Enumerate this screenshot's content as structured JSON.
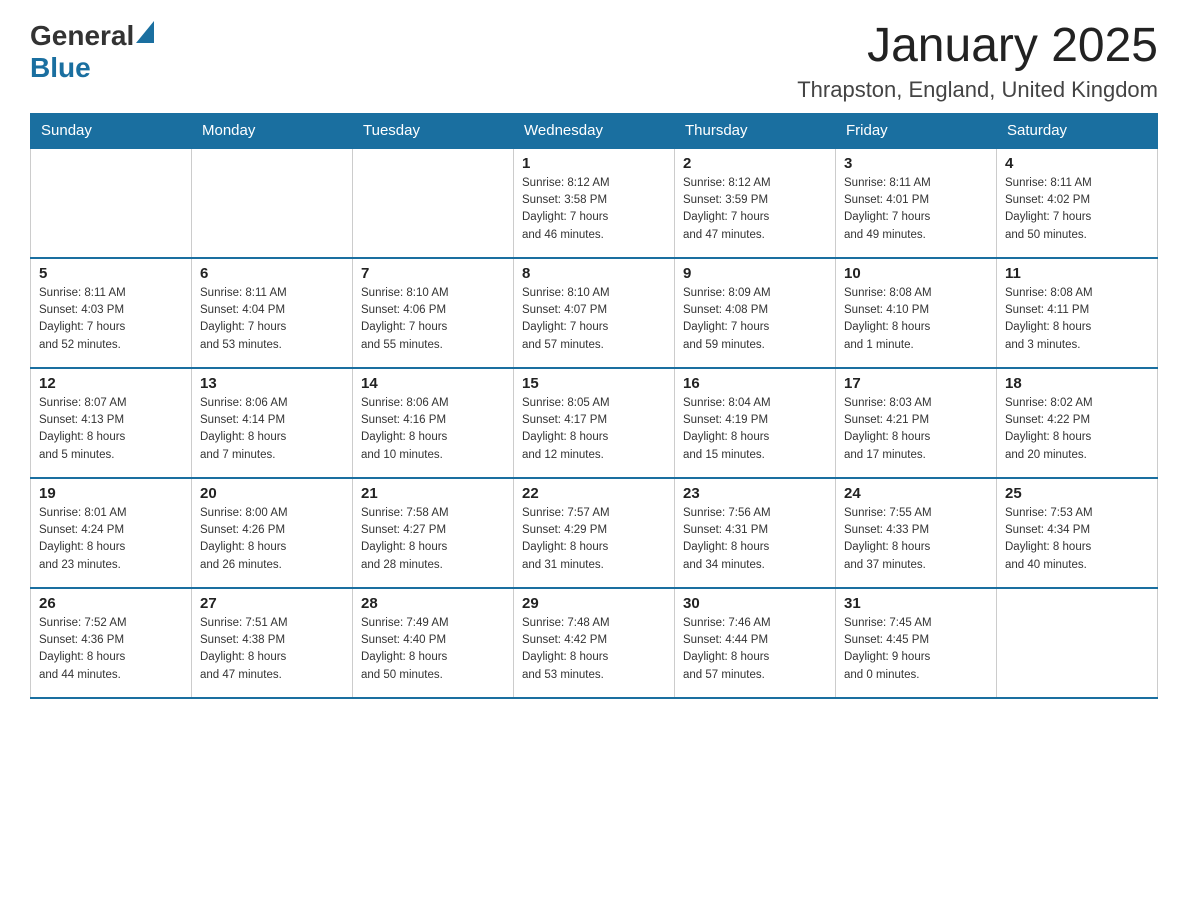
{
  "header": {
    "logo": {
      "general": "General",
      "blue": "Blue"
    },
    "title": "January 2025",
    "location": "Thrapston, England, United Kingdom"
  },
  "days_of_week": [
    "Sunday",
    "Monday",
    "Tuesday",
    "Wednesday",
    "Thursday",
    "Friday",
    "Saturday"
  ],
  "weeks": [
    [
      {
        "day": "",
        "info": ""
      },
      {
        "day": "",
        "info": ""
      },
      {
        "day": "",
        "info": ""
      },
      {
        "day": "1",
        "info": "Sunrise: 8:12 AM\nSunset: 3:58 PM\nDaylight: 7 hours\nand 46 minutes."
      },
      {
        "day": "2",
        "info": "Sunrise: 8:12 AM\nSunset: 3:59 PM\nDaylight: 7 hours\nand 47 minutes."
      },
      {
        "day": "3",
        "info": "Sunrise: 8:11 AM\nSunset: 4:01 PM\nDaylight: 7 hours\nand 49 minutes."
      },
      {
        "day": "4",
        "info": "Sunrise: 8:11 AM\nSunset: 4:02 PM\nDaylight: 7 hours\nand 50 minutes."
      }
    ],
    [
      {
        "day": "5",
        "info": "Sunrise: 8:11 AM\nSunset: 4:03 PM\nDaylight: 7 hours\nand 52 minutes."
      },
      {
        "day": "6",
        "info": "Sunrise: 8:11 AM\nSunset: 4:04 PM\nDaylight: 7 hours\nand 53 minutes."
      },
      {
        "day": "7",
        "info": "Sunrise: 8:10 AM\nSunset: 4:06 PM\nDaylight: 7 hours\nand 55 minutes."
      },
      {
        "day": "8",
        "info": "Sunrise: 8:10 AM\nSunset: 4:07 PM\nDaylight: 7 hours\nand 57 minutes."
      },
      {
        "day": "9",
        "info": "Sunrise: 8:09 AM\nSunset: 4:08 PM\nDaylight: 7 hours\nand 59 minutes."
      },
      {
        "day": "10",
        "info": "Sunrise: 8:08 AM\nSunset: 4:10 PM\nDaylight: 8 hours\nand 1 minute."
      },
      {
        "day": "11",
        "info": "Sunrise: 8:08 AM\nSunset: 4:11 PM\nDaylight: 8 hours\nand 3 minutes."
      }
    ],
    [
      {
        "day": "12",
        "info": "Sunrise: 8:07 AM\nSunset: 4:13 PM\nDaylight: 8 hours\nand 5 minutes."
      },
      {
        "day": "13",
        "info": "Sunrise: 8:06 AM\nSunset: 4:14 PM\nDaylight: 8 hours\nand 7 minutes."
      },
      {
        "day": "14",
        "info": "Sunrise: 8:06 AM\nSunset: 4:16 PM\nDaylight: 8 hours\nand 10 minutes."
      },
      {
        "day": "15",
        "info": "Sunrise: 8:05 AM\nSunset: 4:17 PM\nDaylight: 8 hours\nand 12 minutes."
      },
      {
        "day": "16",
        "info": "Sunrise: 8:04 AM\nSunset: 4:19 PM\nDaylight: 8 hours\nand 15 minutes."
      },
      {
        "day": "17",
        "info": "Sunrise: 8:03 AM\nSunset: 4:21 PM\nDaylight: 8 hours\nand 17 minutes."
      },
      {
        "day": "18",
        "info": "Sunrise: 8:02 AM\nSunset: 4:22 PM\nDaylight: 8 hours\nand 20 minutes."
      }
    ],
    [
      {
        "day": "19",
        "info": "Sunrise: 8:01 AM\nSunset: 4:24 PM\nDaylight: 8 hours\nand 23 minutes."
      },
      {
        "day": "20",
        "info": "Sunrise: 8:00 AM\nSunset: 4:26 PM\nDaylight: 8 hours\nand 26 minutes."
      },
      {
        "day": "21",
        "info": "Sunrise: 7:58 AM\nSunset: 4:27 PM\nDaylight: 8 hours\nand 28 minutes."
      },
      {
        "day": "22",
        "info": "Sunrise: 7:57 AM\nSunset: 4:29 PM\nDaylight: 8 hours\nand 31 minutes."
      },
      {
        "day": "23",
        "info": "Sunrise: 7:56 AM\nSunset: 4:31 PM\nDaylight: 8 hours\nand 34 minutes."
      },
      {
        "day": "24",
        "info": "Sunrise: 7:55 AM\nSunset: 4:33 PM\nDaylight: 8 hours\nand 37 minutes."
      },
      {
        "day": "25",
        "info": "Sunrise: 7:53 AM\nSunset: 4:34 PM\nDaylight: 8 hours\nand 40 minutes."
      }
    ],
    [
      {
        "day": "26",
        "info": "Sunrise: 7:52 AM\nSunset: 4:36 PM\nDaylight: 8 hours\nand 44 minutes."
      },
      {
        "day": "27",
        "info": "Sunrise: 7:51 AM\nSunset: 4:38 PM\nDaylight: 8 hours\nand 47 minutes."
      },
      {
        "day": "28",
        "info": "Sunrise: 7:49 AM\nSunset: 4:40 PM\nDaylight: 8 hours\nand 50 minutes."
      },
      {
        "day": "29",
        "info": "Sunrise: 7:48 AM\nSunset: 4:42 PM\nDaylight: 8 hours\nand 53 minutes."
      },
      {
        "day": "30",
        "info": "Sunrise: 7:46 AM\nSunset: 4:44 PM\nDaylight: 8 hours\nand 57 minutes."
      },
      {
        "day": "31",
        "info": "Sunrise: 7:45 AM\nSunset: 4:45 PM\nDaylight: 9 hours\nand 0 minutes."
      },
      {
        "day": "",
        "info": ""
      }
    ]
  ]
}
